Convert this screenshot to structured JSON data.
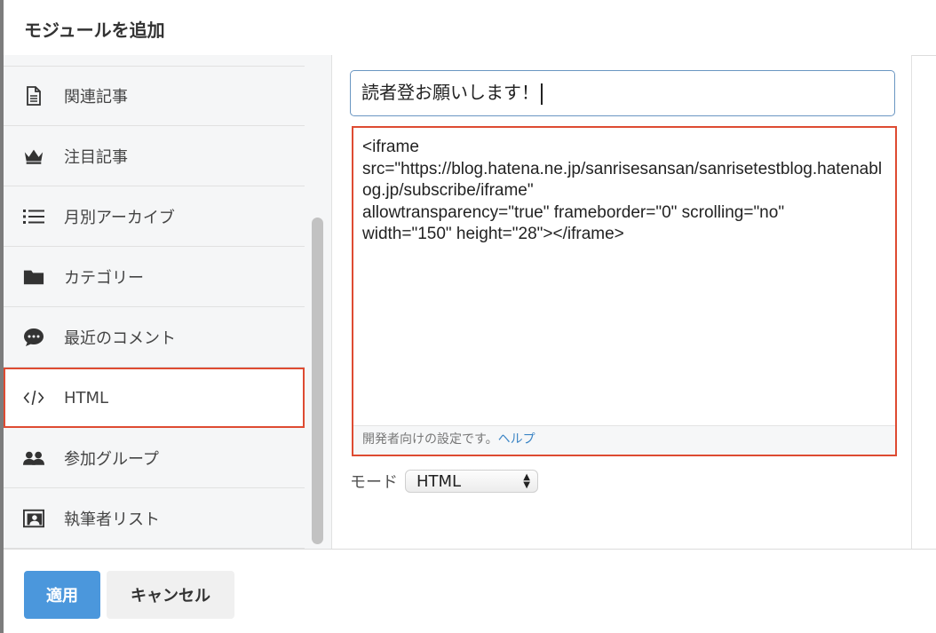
{
  "dialog": {
    "title": "モジュールを追加"
  },
  "sidebar": {
    "items": [
      {
        "label": "関連記事",
        "icon": "document-icon"
      },
      {
        "label": "注目記事",
        "icon": "crown-icon"
      },
      {
        "label": "月別アーカイブ",
        "icon": "list-icon"
      },
      {
        "label": "カテゴリー",
        "icon": "folder-icon"
      },
      {
        "label": "最近のコメント",
        "icon": "comment-bubble-icon"
      },
      {
        "label": "HTML",
        "icon": "code-icon",
        "selected": true
      },
      {
        "label": "参加グループ",
        "icon": "group-icon"
      },
      {
        "label": "執筆者リスト",
        "icon": "author-card-icon"
      }
    ]
  },
  "main": {
    "title_value": "読者登お願いします！",
    "code_value": "<iframe\nsrc=\"https://blog.hatena.ne.jp/sanrisesansan/sanrisetestblog.hatenablog.jp/subscribe/iframe\"\nallowtransparency=\"true\" frameborder=\"0\" scrolling=\"no\"\nwidth=\"150\" height=\"28\"></iframe>",
    "note": "開発者向けの設定です。",
    "help_link": "ヘルプ",
    "mode_label": "モード",
    "mode_value": "HTML"
  },
  "footer": {
    "apply_label": "適用",
    "cancel_label": "キャンセル"
  },
  "colors": {
    "accent": "#4b97dc",
    "highlight": "#de4b32"
  }
}
